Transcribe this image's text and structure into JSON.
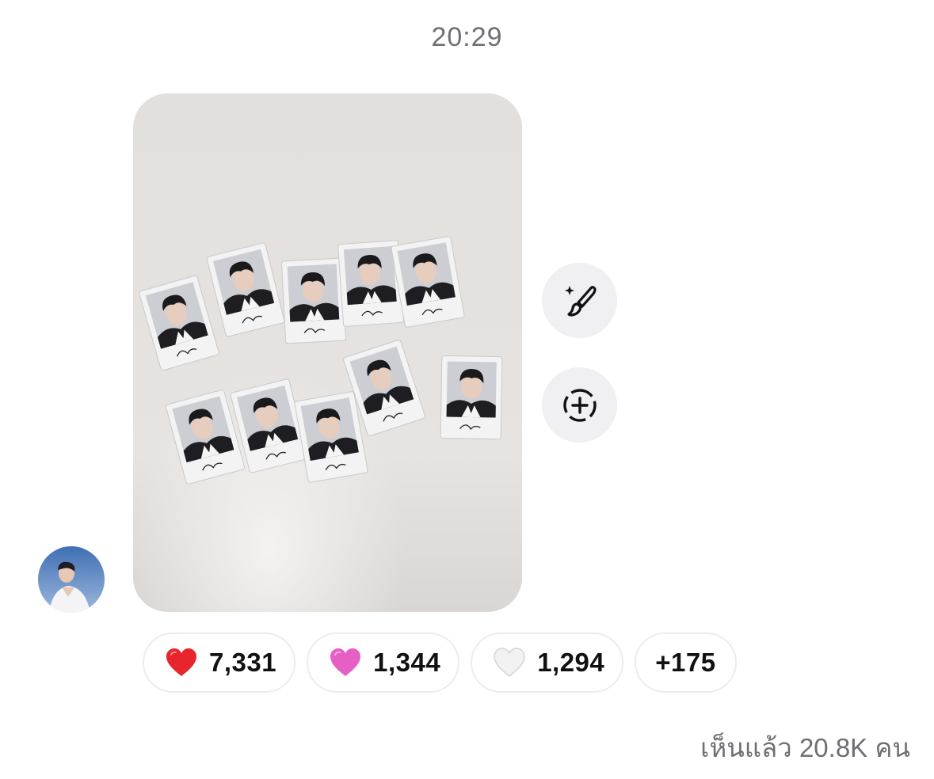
{
  "timestamp": "20:29",
  "photo": {
    "description_icon": "photo-icon",
    "polaroid_count": 10
  },
  "actions": {
    "edit_icon": "sparkle-brush-icon",
    "share_icon": "add-story-icon"
  },
  "avatar": {
    "icon": "profile-avatar"
  },
  "reactions": [
    {
      "emoji": "red-heart",
      "color": "#e8242c",
      "count": "7,331"
    },
    {
      "emoji": "pink-heart",
      "color": "#e65fc4",
      "count": "1,344"
    },
    {
      "emoji": "white-heart",
      "color": "#f2f2f2",
      "count": "1,294"
    }
  ],
  "more_reactions": "+175",
  "seen_by": "เห็นแล้ว 20.8K คน",
  "colors": {
    "muted_text": "#6f6f74",
    "button_bg": "#f0f0f2",
    "pill_border": "#ececee"
  }
}
